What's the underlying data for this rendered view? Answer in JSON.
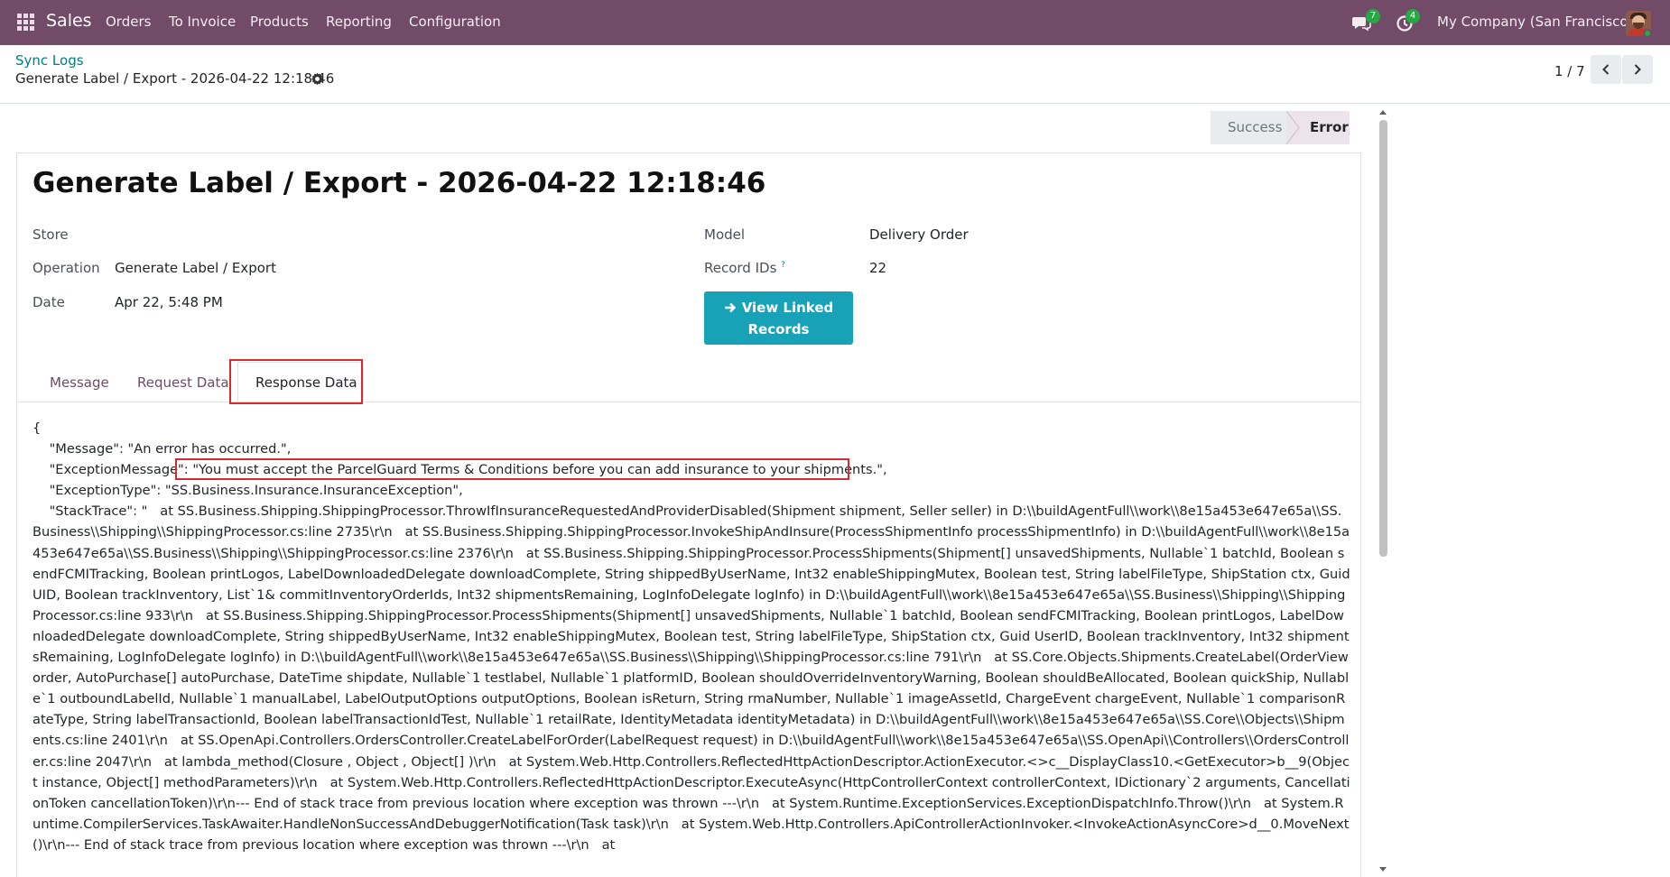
{
  "navbar": {
    "app_name": "Sales",
    "menu": [
      "Orders",
      "To Invoice",
      "Products",
      "Reporting",
      "Configuration"
    ],
    "chat_badge": "7",
    "activity_badge": "4",
    "company": "My Company (San Francisco)",
    "bg_color": "#714b67"
  },
  "control_panel": {
    "breadcrumb": "Sync Logs",
    "record_title": "Generate Label / Export - 2026-04-22 12:18:46",
    "pager": "1 / 7"
  },
  "statusbar": {
    "items": [
      "Success",
      "Error"
    ],
    "active": "Error"
  },
  "form": {
    "title": "Generate Label / Export - 2026-04-22 12:18:46",
    "store_label": "Store",
    "store_value": "",
    "operation_label": "Operation",
    "operation_value": "Generate Label / Export",
    "date_label": "Date",
    "date_value": "Apr 22, 5:48 PM",
    "model_label": "Model",
    "model_value": "Delivery Order",
    "record_ids_label": "Record IDs",
    "record_ids_help": "?",
    "record_ids_value": "22",
    "view_linked_label_line1": "View Linked",
    "view_linked_label_line2": "Records",
    "accent_color": "#17a2b8"
  },
  "tabs": [
    "Message",
    "Request Data",
    "Response Data"
  ],
  "active_tab": "Response Data",
  "response_data": {
    "line_open": "{",
    "line_message": "    \"Message\": \"An error has occurred.\",",
    "line_exception_key": "    \"ExceptionMessage\"",
    "line_exception_value": ": \"You must accept the ParcelGuard Terms & Conditions before you can add insurance to your shipments.\",",
    "line_exception_type": "    \"ExceptionType\": \"SS.Business.Insurance.InsuranceException\",",
    "stack_trace": "    \"StackTrace\": \"   at SS.Business.Shipping.ShippingProcessor.ThrowIfInsuranceRequestedAndProviderDisabled(Shipment shipment, Seller seller) in D:\\\\buildAgentFull\\\\work\\\\8e15a453e647e65a\\\\SS.Business\\\\Shipping\\\\ShippingProcessor.cs:line 2735\\r\\n   at SS.Business.Shipping.ShippingProcessor.InvokeShipAndInsure(ProcessShipmentInfo processShipmentInfo) in D:\\\\buildAgentFull\\\\work\\\\8e15a453e647e65a\\\\SS.Business\\\\Shipping\\\\ShippingProcessor.cs:line 2376\\r\\n   at SS.Business.Shipping.ShippingProcessor.ProcessShipments(Shipment[] unsavedShipments, Nullable`1 batchId, Boolean sendFCMITracking, Boolean printLogos, LabelDownloadedDelegate downloadComplete, String shippedByUserName, Int32 enableShippingMutex, Boolean test, String labelFileType, ShipStation ctx, Guid UID, Boolean trackInventory, List`1& commitInventoryOrderIds, Int32 shipmentsRemaining, LogInfoDelegate logInfo) in D:\\\\buildAgentFull\\\\work\\\\8e15a453e647e65a\\\\SS.Business\\\\Shipping\\\\ShippingProcessor.cs:line 933\\r\\n   at SS.Business.Shipping.ShippingProcessor.ProcessShipments(Shipment[] unsavedShipments, Nullable`1 batchId, Boolean sendFCMITracking, Boolean printLogos, LabelDownloadedDelegate downloadComplete, String shippedByUserName, Int32 enableShippingMutex, Boolean test, String labelFileType, ShipStation ctx, Guid UserID, Boolean trackInventory, Int32 shipmentsRemaining, LogInfoDelegate logInfo) in D:\\\\buildAgentFull\\\\work\\\\8e15a453e647e65a\\\\SS.Business\\\\Shipping\\\\ShippingProcessor.cs:line 791\\r\\n   at SS.Core.Objects.Shipments.CreateLabel(OrderView order, AutoPurchase[] autoPurchase, DateTime shipdate, Nullable`1 testlabel, Nullable`1 platformID, Boolean shouldOverrideInventoryWarning, Boolean shouldBeAllocated, Boolean quickShip, Nullable`1 outboundLabelId, Nullable`1 manualLabel, LabelOutputOptions outputOptions, Boolean isReturn, String rmaNumber, Nullable`1 imageAssetId, ChargeEvent chargeEvent, Nullable`1 comparisonRateType, String labelTransactionId, Boolean labelTransactionIdTest, Nullable`1 retailRate, IdentityMetadata identityMetadata) in D:\\\\buildAgentFull\\\\work\\\\8e15a453e647e65a\\\\SS.Core\\\\Objects\\\\Shipments.cs:line 2401\\r\\n   at SS.OpenApi.Controllers.OrdersController.CreateLabelForOrder(LabelRequest request) in D:\\\\buildAgentFull\\\\work\\\\8e15a453e647e65a\\\\SS.OpenApi\\\\Controllers\\\\OrdersController.cs:line 2047\\r\\n   at lambda_method(Closure , Object , Object[] )\\r\\n   at System.Web.Http.Controllers.ReflectedHttpActionDescriptor.ActionExecutor.<>c__DisplayClass10.<GetExecutor>b__9(Object instance, Object[] methodParameters)\\r\\n   at System.Web.Http.Controllers.ReflectedHttpActionDescriptor.ExecuteAsync(HttpControllerContext controllerContext, IDictionary`2 arguments, CancellationToken cancellationToken)\\r\\n--- End of stack trace from previous location where exception was thrown ---\\r\\n   at System.Runtime.ExceptionServices.ExceptionDispatchInfo.Throw()\\r\\n   at System.Runtime.CompilerServices.TaskAwaiter.HandleNonSuccessAndDebuggerNotification(Task task)\\r\\n   at System.Web.Http.Controllers.ApiControllerActionInvoker.<InvokeActionAsyncCore>d__0.MoveNext()\\r\\n--- End of stack trace from previous location where exception was thrown ---\\r\\n   at"
  },
  "highlight_color": "#d62b2b",
  "link_color": "#017e84"
}
